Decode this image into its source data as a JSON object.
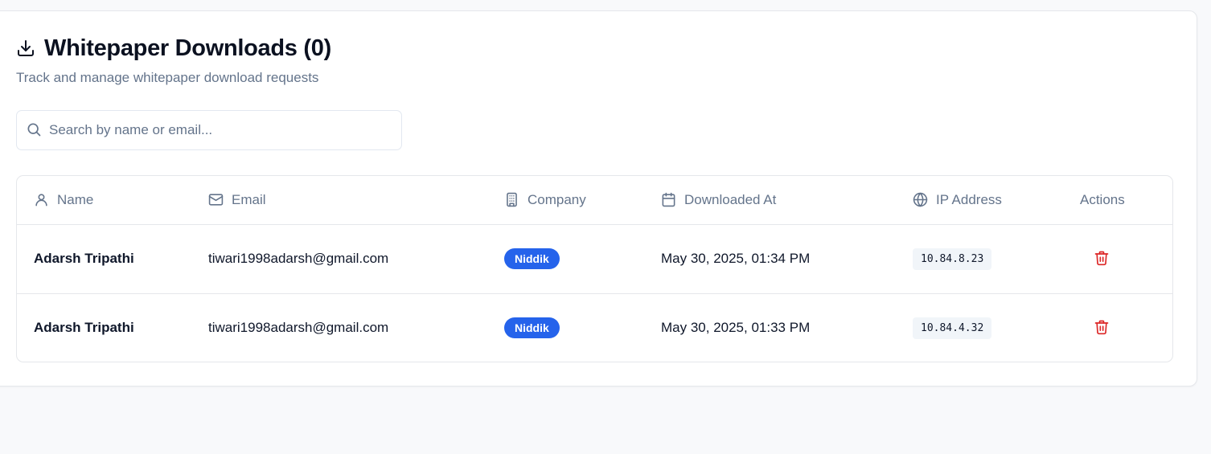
{
  "header": {
    "title": "Whitepaper Downloads (0)",
    "subtitle": "Track and manage whitepaper download requests"
  },
  "search": {
    "placeholder": "Search by name or email...",
    "value": ""
  },
  "table": {
    "columns": {
      "name": "Name",
      "email": "Email",
      "company": "Company",
      "downloaded_at": "Downloaded At",
      "ip": "IP Address",
      "actions": "Actions"
    },
    "rows": [
      {
        "name": "Adarsh Tripathi",
        "email": "tiwari1998adarsh@gmail.com",
        "company": "Niddik",
        "downloaded_at": "May 30, 2025, 01:34 PM",
        "ip": "10.84.8.23"
      },
      {
        "name": "Adarsh Tripathi",
        "email": "tiwari1998adarsh@gmail.com",
        "company": "Niddik",
        "downloaded_at": "May 30, 2025, 01:33 PM",
        "ip": "10.84.4.32"
      }
    ]
  },
  "icons": {
    "title": "download-icon",
    "search": "search-icon",
    "name_column": "user-icon",
    "email_column": "mail-icon",
    "company_column": "building-icon",
    "date_column": "calendar-icon",
    "ip_column": "globe-icon",
    "delete": "trash-icon"
  },
  "colors": {
    "badge": "#2563eb",
    "delete": "#dc2626",
    "muted_text": "#64748b"
  }
}
